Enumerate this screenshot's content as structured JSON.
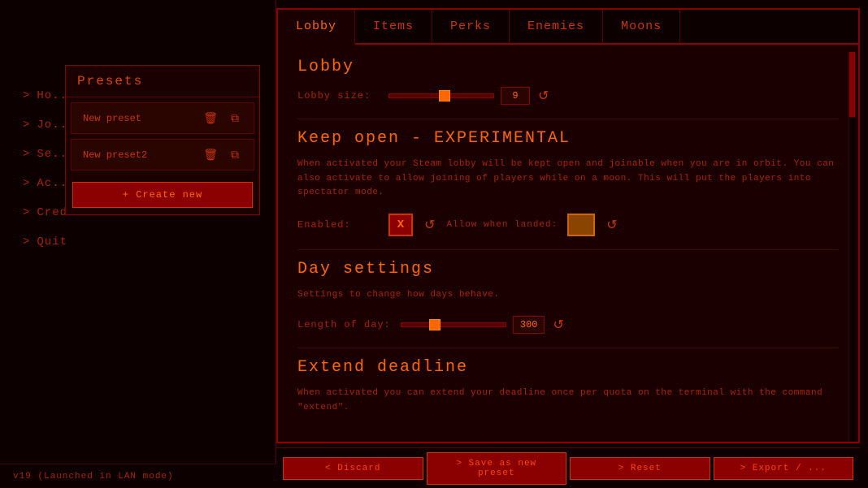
{
  "sidebar": {
    "menu_items": [
      {
        "id": "host",
        "label": "Ho..."
      },
      {
        "id": "join",
        "label": "Jo..."
      },
      {
        "id": "settings",
        "label": "Se..."
      },
      {
        "id": "achievements",
        "label": "Ac..."
      },
      {
        "id": "credits",
        "label": "Credits"
      },
      {
        "id": "quit",
        "label": "Quit"
      }
    ],
    "status": "v19  (Launched in LAN mode)"
  },
  "presets": {
    "title": "Presets",
    "items": [
      {
        "id": "preset1",
        "label": "New preset"
      },
      {
        "id": "preset2",
        "label": "New preset2"
      }
    ],
    "create_btn": "+ Create new"
  },
  "tabs": {
    "items": [
      {
        "id": "lobby",
        "label": "Lobby",
        "active": true
      },
      {
        "id": "items",
        "label": "Items"
      },
      {
        "id": "perks",
        "label": "Perks"
      },
      {
        "id": "enemies",
        "label": "Enemies"
      },
      {
        "id": "moons",
        "label": "Moons"
      }
    ]
  },
  "lobby_section": {
    "title": "Lobby",
    "lobby_size": {
      "label": "Lobby size:",
      "value": "9",
      "min": 1,
      "max": 16
    }
  },
  "keep_open_section": {
    "title": "Keep open - EXPERIMENTAL",
    "description": "When activated your Steam lobby will be kept open and joinable when you\nare in orbit. You can also activate to allow joining of players while on a\nmoon. This will put the players into spectator mode.",
    "enabled": {
      "label": "Enabled:",
      "value": true,
      "display": "X"
    },
    "allow_when_landed": {
      "label": "Allow when\nlanded:",
      "value": false
    }
  },
  "day_settings_section": {
    "title": "Day settings",
    "description": "Settings to change how days behave.",
    "length_of_day": {
      "label": "Length of day:",
      "value": "300",
      "min": 1,
      "max": 1000
    }
  },
  "extend_deadline_section": {
    "title": "Extend deadline",
    "description": "When activated you can extend your deadline once per quota on the terminal\nwith the command \"extend\"."
  },
  "toolbar": {
    "btn1": "< Discard",
    "btn2": "> Save as new preset",
    "btn3": "> Reset",
    "btn4": "> Export / ..."
  },
  "icons": {
    "delete": "🗑",
    "copy": "⧉",
    "reset": "↺",
    "chevron": ">",
    "check": "X"
  }
}
